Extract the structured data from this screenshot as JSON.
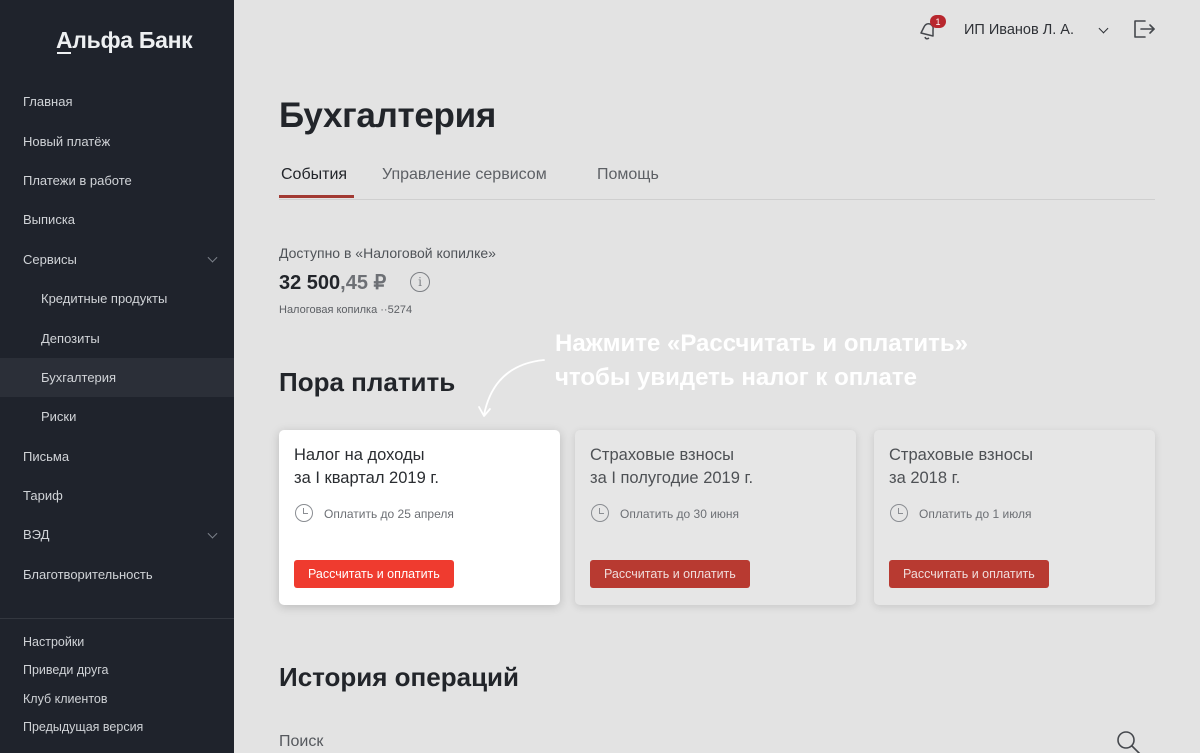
{
  "brand": {
    "name": "Альфа Банк"
  },
  "sidebar": {
    "items": [
      {
        "label": "Главная"
      },
      {
        "label": "Новый платёж"
      },
      {
        "label": "Платежи в работе"
      },
      {
        "label": "Выписка"
      },
      {
        "label": "Сервисы"
      },
      {
        "label": "Кредитные продукты"
      },
      {
        "label": "Депозиты"
      },
      {
        "label": "Бухгалтерия"
      },
      {
        "label": "Риски"
      },
      {
        "label": "Письма"
      },
      {
        "label": "Тариф"
      },
      {
        "label": "ВЭД"
      },
      {
        "label": "Благотворительность"
      }
    ],
    "bottom_items": [
      {
        "label": "Настройки"
      },
      {
        "label": "Приведи друга"
      },
      {
        "label": "Клуб клиентов"
      },
      {
        "label": "Предыдущая версия"
      }
    ]
  },
  "header": {
    "notifications_count": "1",
    "user_name": "ИП Иванов Л. А.",
    "icons": [
      "bell-icon",
      "chevron-down-icon",
      "logout-icon"
    ]
  },
  "page": {
    "title": "Бухгалтерия",
    "tabs": [
      {
        "label": "События"
      },
      {
        "label": "Управление сервисом"
      },
      {
        "label": "Помощь"
      }
    ],
    "active_tab": "События"
  },
  "balance": {
    "label": "Доступно в «Налоговой копилке»",
    "amount_int": "32 500",
    "amount_dec": ",45 ₽",
    "account": "Налоговая копилка ··5274"
  },
  "pay_section": {
    "title": "Пора платить",
    "hint_line1": "Нажмите «Рассчитать и оплатить»",
    "hint_line2": "чтобы увидеть налог к оплате",
    "cards": [
      {
        "title": "Налог на доходы\nза I квартал 2019 г.",
        "due": "Оплатить до 25 апреля",
        "button": "Рассчитать и оплатить"
      },
      {
        "title": "Страховые взносы\nза I полугодие 2019 г.",
        "due": "Оплатить до 30 июня",
        "button": "Рассчитать и оплатить"
      },
      {
        "title": "Страховые взносы\nза 2018 г.",
        "due": "Оплатить до 1 июля",
        "button": "Рассчитать и оплатить"
      }
    ]
  },
  "history": {
    "title": "История операций",
    "search_placeholder": "Поиск"
  },
  "colors": {
    "sidebar_bg": "#1f232c",
    "accent_red": "#ef3b2f",
    "tab_underline": "#a23a33"
  }
}
